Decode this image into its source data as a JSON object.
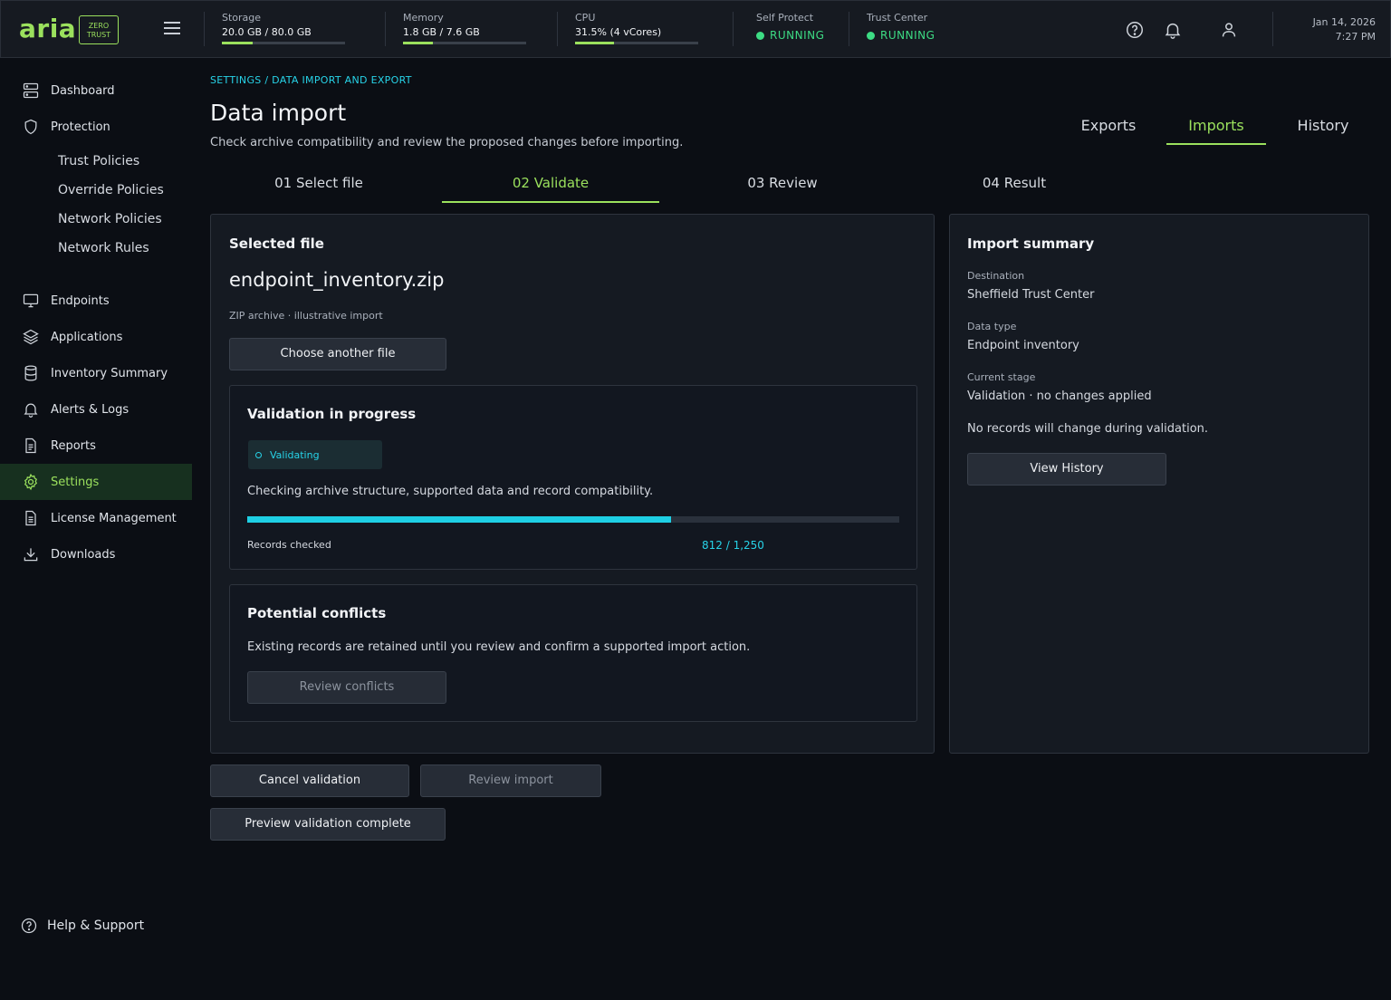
{
  "brand": {
    "logo": "aria",
    "badge_line1": "ZERO",
    "badge_line2": "TRUST"
  },
  "topbar": {
    "storage": {
      "label": "Storage",
      "value": "20.0 GB / 80.0 GB",
      "fraction": 0.25
    },
    "memory": {
      "label": "Memory",
      "value": "1.8 GB / 7.6 GB",
      "fraction": 0.24
    },
    "cpu": {
      "label": "CPU",
      "value": "31.5% (4 vCores)",
      "fraction": 0.315
    },
    "self_protect": {
      "label": "Self Protect",
      "status": "RUNNING"
    },
    "trust_center": {
      "label": "Trust Center",
      "status": "RUNNING"
    },
    "date": "Jan 14, 2026",
    "time": "7:27 PM",
    "icons": [
      "help-icon",
      "bell-icon",
      "user-icon"
    ]
  },
  "sidebar": {
    "items": [
      {
        "label": "Dashboard",
        "icon": "server-icon"
      },
      {
        "label": "Protection",
        "icon": "shield-icon"
      },
      {
        "label": "Endpoints",
        "icon": "monitor-icon"
      },
      {
        "label": "Applications",
        "icon": "layers-icon"
      },
      {
        "label": "Inventory Summary",
        "icon": "database-icon"
      },
      {
        "label": "Alerts & Logs",
        "icon": "bell-icon"
      },
      {
        "label": "Reports",
        "icon": "document-icon"
      },
      {
        "label": "Settings",
        "icon": "gear-icon"
      },
      {
        "label": "License Management",
        "icon": "license-icon"
      },
      {
        "label": "Downloads",
        "icon": "download-icon"
      }
    ],
    "sub_items": [
      "Trust Policies",
      "Override Policies",
      "Network Policies",
      "Network Rules"
    ],
    "help": "Help & Support",
    "active": "Settings"
  },
  "page": {
    "breadcrumb": "SETTINGS / DATA IMPORT AND EXPORT",
    "title": "Data import",
    "subtitle": "Check archive compatibility and review the proposed changes before importing.",
    "tabs": [
      "Exports",
      "Imports",
      "History"
    ],
    "active_tab": "Imports",
    "steps": [
      "01 Select file",
      "02 Validate",
      "03 Review",
      "04 Result"
    ],
    "active_step": "02 Validate"
  },
  "selected_file": {
    "heading": "Selected file",
    "filename": "endpoint_inventory.zip",
    "meta": "ZIP archive · illustrative import",
    "choose_button": "Choose another file"
  },
  "validation": {
    "heading": "Validation in progress",
    "badge": "Validating",
    "description": "Checking archive structure, supported data and record compatibility.",
    "progress_fraction": 0.65,
    "records_label": "Records checked",
    "records_value": "812 / 1,250"
  },
  "conflicts": {
    "heading": "Potential conflicts",
    "description": "Existing records are retained until you review and confirm a supported import action.",
    "button": "Review conflicts"
  },
  "summary": {
    "heading": "Import summary",
    "destination_label": "Destination",
    "destination_value": "Sheffield Trust Center",
    "data_type_label": "Data type",
    "data_type_value": "Endpoint inventory",
    "stage_label": "Current stage",
    "stage_value": "Validation · no changes applied",
    "note": "No records will change during validation.",
    "history_button": "View History"
  },
  "actions": {
    "cancel": "Cancel validation",
    "review": "Review import",
    "preview": "Preview validation complete"
  },
  "colors": {
    "accent": "#9be15d",
    "cyan": "#27d3e8",
    "running": "#3ddc84",
    "background": "#0b0e14"
  }
}
